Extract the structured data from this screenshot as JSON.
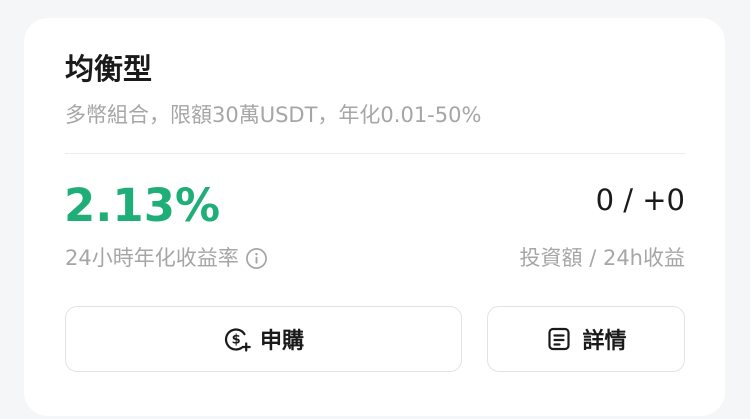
{
  "card": {
    "title": "均衡型",
    "subtitle": "多幣組合，限額30萬USDT，年化0.01-50%"
  },
  "stats": {
    "apr_value": "2.13%",
    "apr_label": "24小時年化收益率",
    "investment_value": "0 / +0",
    "investment_label": "投資額 / 24h收益"
  },
  "actions": {
    "subscribe_label": "申購",
    "details_label": "詳情"
  },
  "colors": {
    "accent_green": "#1fae78",
    "text_primary": "#1a1a1a",
    "text_secondary": "#a6a6a6"
  },
  "icons": {
    "info": "info-icon",
    "subscribe": "dollar-plus-icon",
    "details": "document-icon"
  }
}
